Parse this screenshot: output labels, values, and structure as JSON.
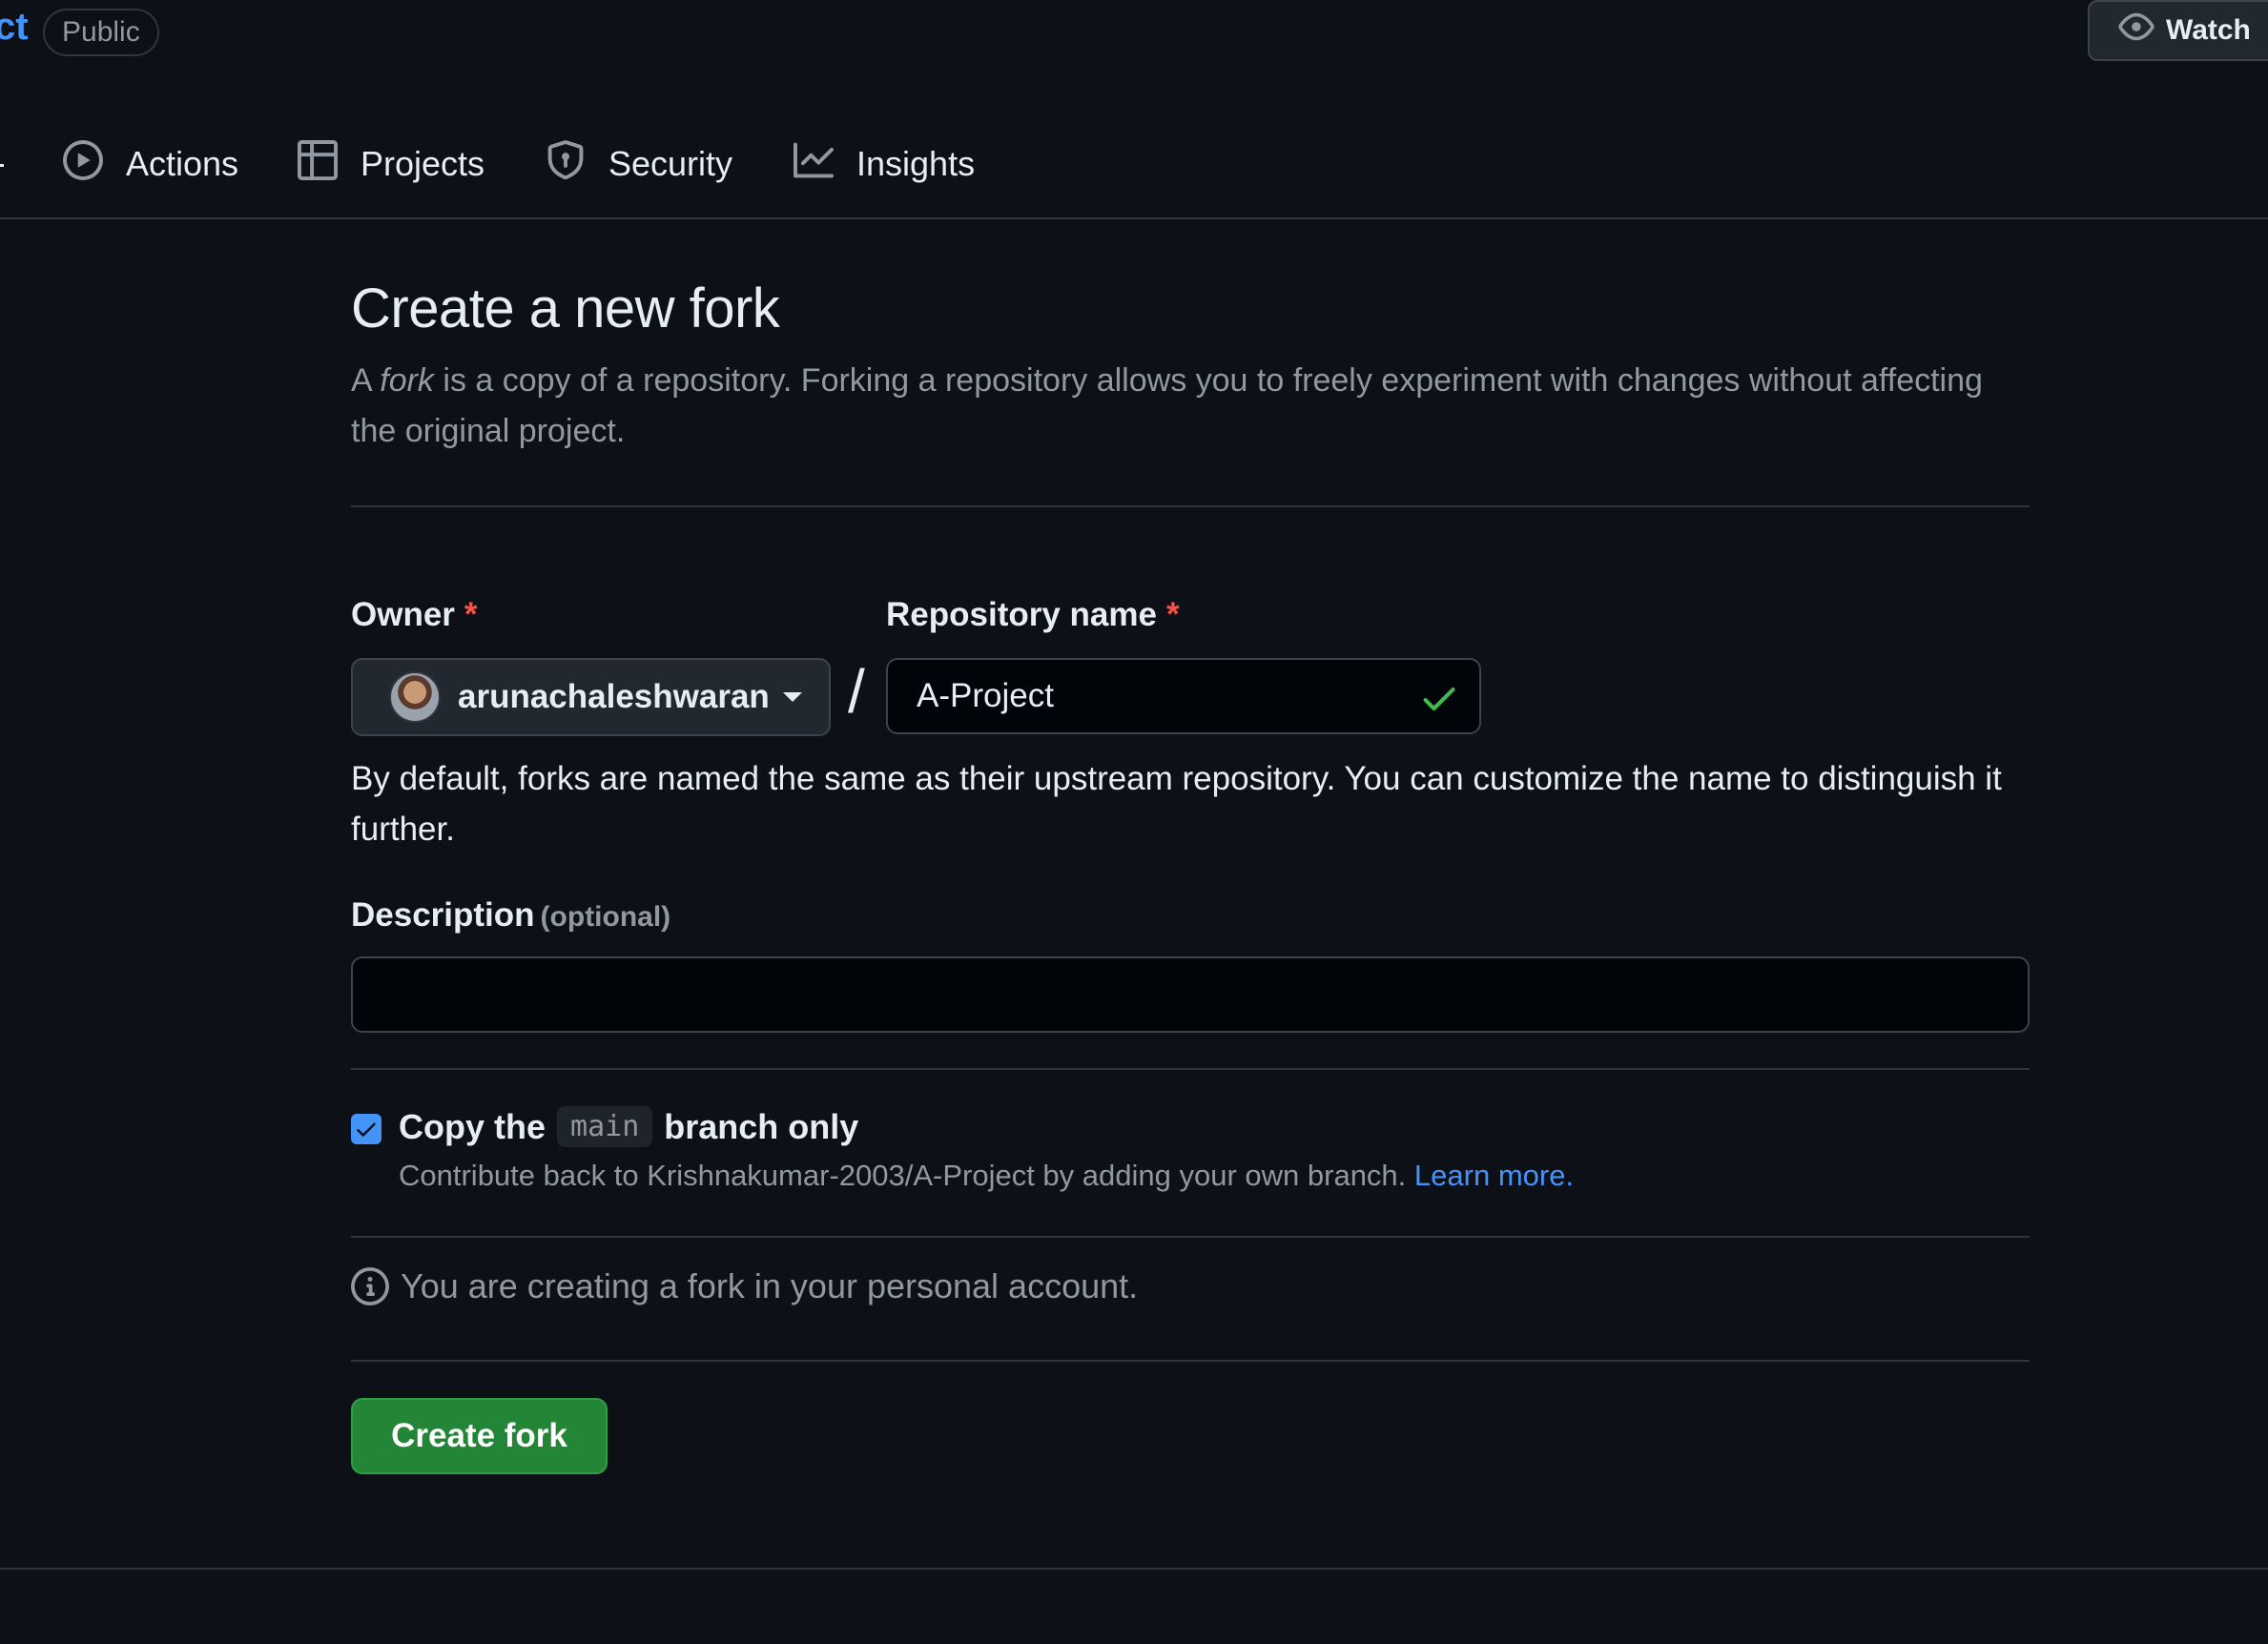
{
  "header": {
    "repo_name_fragment": "ct",
    "visibility": "Public",
    "watch_label": "Watch"
  },
  "tabs": [
    {
      "label": "Actions",
      "icon": "play-circle-icon"
    },
    {
      "label": "Projects",
      "icon": "table-icon"
    },
    {
      "label": "Security",
      "icon": "shield-icon"
    },
    {
      "label": "Insights",
      "icon": "graph-icon"
    }
  ],
  "form": {
    "title": "Create a new fork",
    "intro_prefix": "A ",
    "intro_em": "fork",
    "intro_suffix": " is a copy of a repository. Forking a repository allows you to freely experiment with changes without affecting the original project.",
    "owner_label": "Owner",
    "required_mark": "*",
    "owner_value": "arunachaleshwaran",
    "slash": "/",
    "repo_label": "Repository name",
    "repo_value": "A-Project",
    "name_hint": "By default, forks are named the same as their upstream repository. You can customize the name to distinguish it further.",
    "description_label": "Description",
    "description_optional": "(optional)",
    "description_value": "",
    "copy_prefix": "Copy the",
    "copy_branch": "main",
    "copy_suffix": "branch only",
    "copy_checked": true,
    "copy_hint": "Contribute back to Krishnakumar-2003/A-Project by adding your own branch.",
    "learn_more": "Learn more.",
    "info_text": "You are creating a fork in your personal account.",
    "submit_label": "Create fork"
  },
  "colors": {
    "background": "#0d1117",
    "accent": "#4493f8",
    "primary_button": "#238636",
    "success_check": "#3fb950",
    "required": "#f85149"
  }
}
